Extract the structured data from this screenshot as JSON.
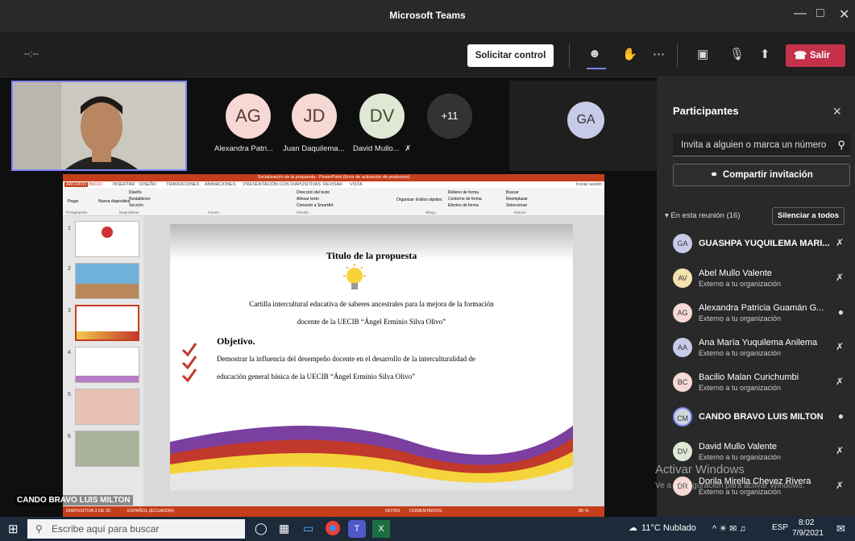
{
  "window": {
    "title": "Microsoft Teams"
  },
  "toolbar": {
    "timer": "--:--",
    "request_control": "Solicitar control",
    "leave": "Salir"
  },
  "stage": {
    "avatars": [
      {
        "initials": "AG",
        "name": "Alexandra Patri...",
        "color": "#f6d9d4"
      },
      {
        "initials": "JD",
        "name": "Juan Daquilema...",
        "color": "#f6d9d4"
      },
      {
        "initials": "DV",
        "name": "David Mullo...",
        "color": "#dfe8d5"
      },
      {
        "initials": "+11",
        "name": "",
        "color": "#333333"
      }
    ],
    "side_avatar": "GA",
    "presenter_caption": "CANDO BRAVO LUIS MILTON",
    "activation_1": "Activar Windows",
    "activation_2": "Ve a Configuración para activar Windows."
  },
  "powerpoint": {
    "titlebar": "Socialización de la propuesta - PowerPoint (Error de activación de productos)",
    "menu": [
      "ARCHIVO",
      "INICIO",
      "INSERTAR",
      "DISEÑO",
      "TRANSICIONES",
      "ANIMACIONES",
      "PRESENTACIÓN CON DIAPOSITIVAS",
      "REVISAR",
      "VISTA"
    ],
    "login": "Iniciar sesión",
    "ribbon_groups": [
      "Portapapeles",
      "Diapositivas",
      "Fuente",
      "Párrafo",
      "Dibujo",
      "Edición"
    ],
    "ribbon_items": [
      "Pegar",
      "Nueva diapositiva",
      "Diseño",
      "Restablecer",
      "Sección",
      "Dirección del texto",
      "Alinear texto",
      "Convertir a SmartArt",
      "Organizar",
      "Estilos rápidos",
      "Relleno de forma",
      "Contorno de forma",
      "Efectos de forma",
      "Buscar",
      "Reemplazar",
      "Seleccionar"
    ],
    "thumb_numbers": [
      "1",
      "2",
      "3",
      "4",
      "5",
      "6"
    ],
    "status_left": "DIAPOSITIVA 3 DE 20",
    "status_lang": "ESPAÑOL (ECUADOR)",
    "status_notes": "NOTAS",
    "status_comments": "COMENTARIOS",
    "zoom": "80 %"
  },
  "slide": {
    "title": "Titulo de la propuesta",
    "line1": "Cartilla intercultural educativa de saberes ancestrales para la mejora de la formación",
    "line2": "docente de la UECIB “Ángel Erminio Silva Olivo”",
    "objective_label": "Objetivo.",
    "objective_line1": "Demostrar la influencia del desempeño docente en el desarrollo de la interculturalidad de",
    "objective_line2": "educación general básica de la UECIB “Ángel Erminio Silva Olivo”"
  },
  "panel": {
    "title": "Participantes",
    "invite_placeholder": "Invita a alguien o marca un número",
    "share": "Compartir invitación",
    "in_meeting": "En esta reunión (16)",
    "mute_all": "Silenciar a todos",
    "participants": [
      {
        "initials": "GA",
        "name": "GUASHPA YUQUILEMA MARI...",
        "sub": "",
        "color": "#c7cbe8",
        "bold": true
      },
      {
        "initials": "AV",
        "name": "Abel Mullo Valente",
        "sub": "Externo a tu organización",
        "color": "#f3e2b0",
        "bold": false
      },
      {
        "initials": "AG",
        "name": "Alexandra Patricia Guamán G...",
        "sub": "Externo a tu organización",
        "color": "#f6d9d4",
        "bold": false
      },
      {
        "initials": "AA",
        "name": "Ana María Yuquilema Anilema",
        "sub": "Externo a tu organización",
        "color": "#c7cbe8",
        "bold": false
      },
      {
        "initials": "BC",
        "name": "Bacilio Malan Curichumbi",
        "sub": "Externo a tu organización",
        "color": "#f6d9d4",
        "bold": false
      },
      {
        "initials": "CM",
        "name": "CANDO BRAVO LUIS MILTON",
        "sub": "",
        "color": "#cfd6dc",
        "bold": true
      },
      {
        "initials": "DV",
        "name": "David Mullo Valente",
        "sub": "Externo a tu organización",
        "color": "#dfe8d5",
        "bold": false
      },
      {
        "initials": "DR",
        "name": "Dorila Mirella Chevez Rivera",
        "sub": "Externo a tu organización",
        "color": "#f6d9d4",
        "bold": false
      }
    ]
  },
  "taskbar": {
    "search_placeholder": "Escribe aquí para buscar",
    "weather": "11°C Nublado",
    "lang": "ESP",
    "time": "8:02",
    "date": "7/9/2021"
  }
}
